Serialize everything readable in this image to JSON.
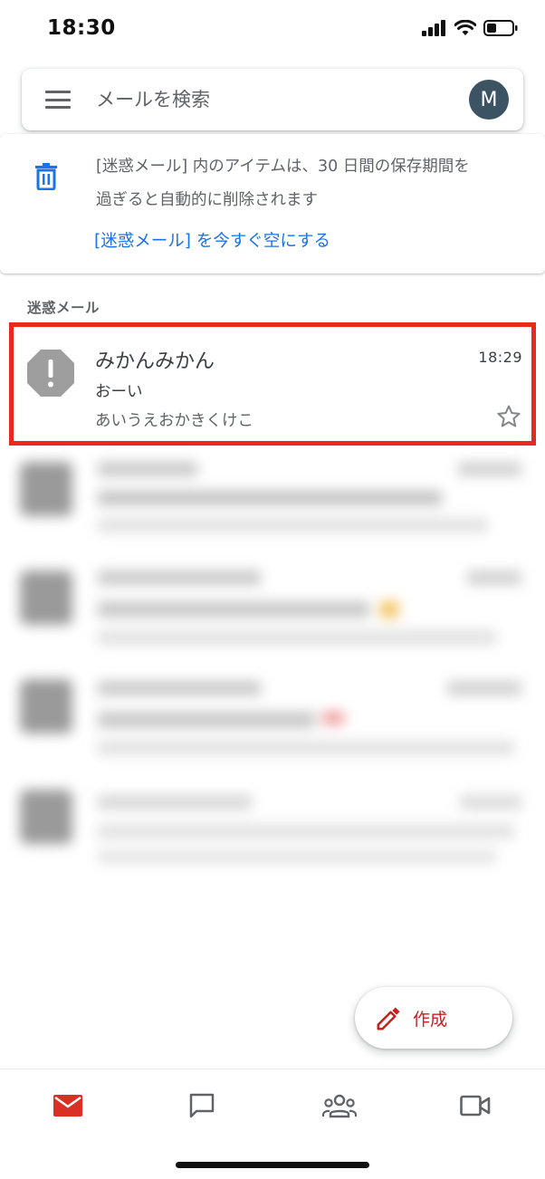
{
  "status_bar": {
    "time": "18:30",
    "icons": [
      "signal-icon",
      "wifi-icon",
      "battery-icon"
    ]
  },
  "search": {
    "placeholder": "メールを検索",
    "menu_icon": "menu-icon",
    "avatar_letter": "M",
    "avatar_color": "#3c5363"
  },
  "notice": {
    "icon": "trash-icon",
    "text_line1": "[迷惑メール] 内のアイテムは、30 日間の保存期間を",
    "text_line2": "過ぎると自動的に削除されます",
    "action": "[迷惑メール] を今すぐ空にする",
    "action_color": "#1a73e8"
  },
  "section": {
    "label": "迷惑メール"
  },
  "mail": {
    "sender": "みかんみかん",
    "time": "18:29",
    "subject": "おーい",
    "snippet": "あいうえおかきくけこ",
    "avatar_icon": "spam-warning-icon",
    "starred": false,
    "highlight_color": "#e8291c"
  },
  "compose": {
    "label": "作成",
    "icon": "pencil-icon",
    "color": "#c5221f"
  },
  "bottom_nav": {
    "items": [
      {
        "icon": "mail-icon",
        "active": true,
        "color": "#d93025"
      },
      {
        "icon": "chat-icon",
        "active": false
      },
      {
        "icon": "spaces-icon",
        "active": false
      },
      {
        "icon": "meet-video-icon",
        "active": false
      }
    ]
  }
}
